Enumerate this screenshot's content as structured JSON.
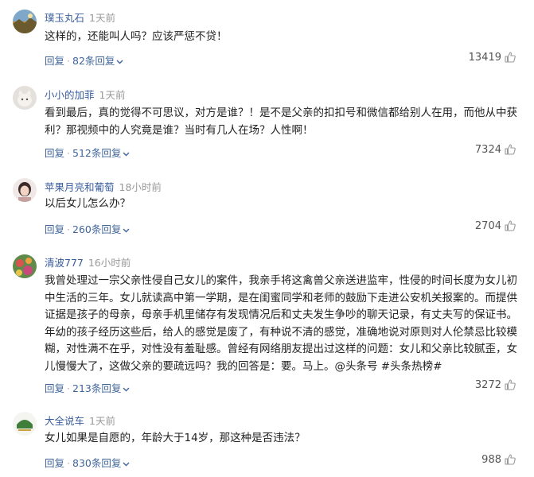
{
  "comments": [
    {
      "username": "璞玉丸石",
      "time": "1天前",
      "text": "这样的，还能叫人吗？应该严惩不贷！",
      "reply_label": "回复",
      "reply_count": "82条回复",
      "likes": "13419"
    },
    {
      "username": "小小的加菲",
      "time": "1天前",
      "text": "看到最后，真的觉得不可思议，对方是谁？！是不是父亲的扣扣号和微信都给别人在用，而他从中获利？那视频中的人究竟是谁？当时有几人在场？人性啊！",
      "reply_label": "回复",
      "reply_count": "512条回复",
      "likes": "7324"
    },
    {
      "username": "苹果月亮和葡萄",
      "time": "18小时前",
      "text": "以后女儿怎么办？",
      "reply_label": "回复",
      "reply_count": "260条回复",
      "likes": "2704"
    },
    {
      "username": "清波777",
      "time": "16小时前",
      "text": "我曾处理过一宗父亲性侵自己女儿的案件，我亲手将这禽兽父亲送进监牢，性侵的时间长度为女儿初中生活的三年。女儿就读高中第一学期，是在闺蜜同学和老师的鼓励下走进公安机关报案的。而提供证据是孩子的母亲，母亲手机里储存有发现情况后和丈夫发生争吵的聊天记录，有丈夫写的保证书。年幼的孩子经历这些后，给人的感觉是废了，有种说不清的感觉，准确地说对原则对人伦禁忌比较模糊，对性满不在乎，对性没有羞耻感。曾经有网络朋友提出过这样的问题：女儿和父亲比较腻歪，女儿慢慢大了，这做父亲的要疏远吗？我的回答是：要。马上。@头条号 #头条热榜#",
      "reply_label": "回复",
      "reply_count": "213条回复",
      "likes": "3272"
    },
    {
      "username": "大全说车",
      "time": "1天前",
      "text": "女儿如果是自愿的，年龄大于14岁，那这种是否违法？",
      "reply_label": "回复",
      "reply_count": "830条回复",
      "likes": "988"
    }
  ],
  "colors": {
    "username": "#3a5d9c",
    "action_link": "#406599",
    "muted": "#999999"
  },
  "icons": {
    "like": "thumbs-up-icon",
    "expand": "chevron-down-icon"
  }
}
